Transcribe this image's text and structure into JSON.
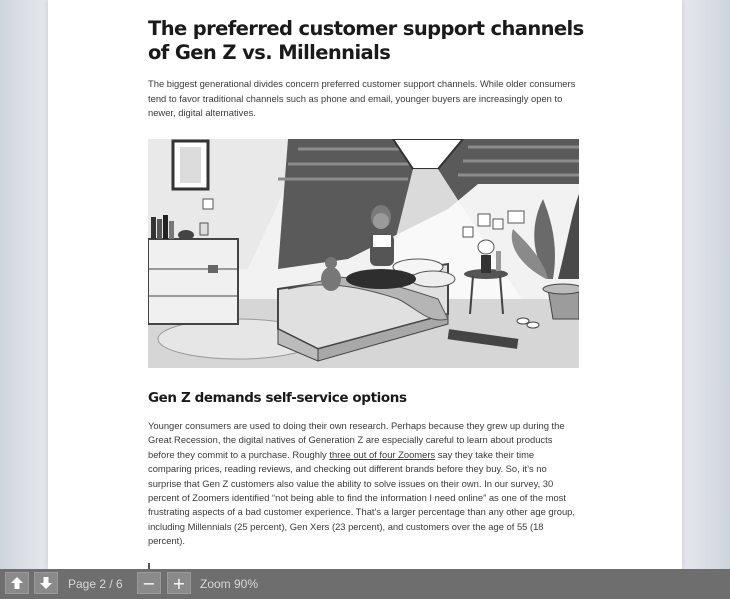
{
  "article": {
    "title": "The preferred customer support channels of Gen Z vs. Millennials",
    "intro": "The biggest generational divides concern preferred customer support channels. While older consumers tend to favor traditional channels such as phone and email, younger buyers are increasingly open to newer, digital alternatives.",
    "section_heading": "Gen Z demands self-service options",
    "body_before_link": "Younger consumers are used to doing their own research. Perhaps because they grew up during the Great Recession, the digital natives of Generation Z are especially careful to learn about products before they commit to a purchase. Roughly ",
    "body_link": "three out of four Zoomers",
    "body_after_link": " say they take their time comparing prices, reading reviews, and checking out different brands before they buy. So, it’s no surprise that Gen Z customers also value the ability to solve issues on their own. In our survey, 30 percent of Zoomers identified “not being able to find the information I need online” as one of the most frustrating aspects of a bad customer experience. That’s a larger percentage than any other age group, including Millennials (25 percent), Gen Xers (23 percent), and customers over the age of 55 (18 percent)."
  },
  "toolbar": {
    "page_label": "Page 2 / 6",
    "zoom_label": "Zoom 90%",
    "zoom_out_glyph": "−",
    "zoom_in_glyph": "+",
    "icons": {
      "prev": "arrow-up-icon",
      "next": "arrow-down-icon"
    }
  }
}
